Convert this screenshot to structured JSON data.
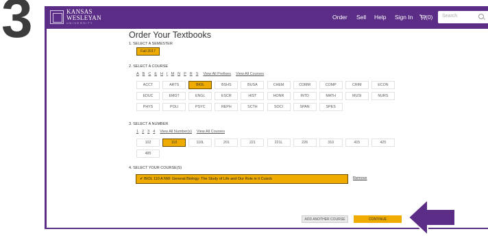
{
  "step_number": "3",
  "header": {
    "logo_line1": "KANSAS",
    "logo_line2": "WESLEYAN",
    "logo_line3": "UNIVERSITY",
    "nav": [
      {
        "label": "Order"
      },
      {
        "label": "Sell"
      },
      {
        "label": "Help"
      },
      {
        "label": "Sign In"
      }
    ],
    "cart_label": "(0)",
    "search_placeholder": "Search"
  },
  "page": {
    "title": "Order Your Textbooks",
    "semester": {
      "heading": "1. SELECT A SEMESTER",
      "selected": "Fall 2017"
    },
    "course": {
      "heading": "2. SELECT A COURSE",
      "letters": [
        "A",
        "B",
        "C",
        "E",
        "H",
        "I",
        "M",
        "N",
        "P",
        "R",
        "S"
      ],
      "view_all_prefixes": "View All Prefixes",
      "view_all_courses": "View All Courses",
      "rows": [
        [
          "ACCT",
          "ARTS",
          "BIOL",
          "BSHS",
          "BUSA",
          "CHEM",
          "COMM",
          "COMP",
          "CRIM",
          "ECON"
        ],
        [
          "EDUC",
          "EMGT",
          "ENGL",
          "ESCR",
          "HIST",
          "HONR",
          "INTD",
          "MATH",
          "MUSI",
          "NURS"
        ],
        [
          "PHYS",
          "POLI",
          "PSYC",
          "REPH",
          "SCTH",
          "SOCI",
          "SPAN",
          "SPES"
        ]
      ],
      "selected": "BIOL"
    },
    "number": {
      "heading": "3. SELECT A NUMBER",
      "pages": [
        "1",
        "2",
        "3",
        "4"
      ],
      "view_all_numbers": "View All Number(s)",
      "view_all_courses": "View All Courses",
      "rows": [
        [
          "102",
          "110",
          "110L",
          "201",
          "221",
          "221L",
          "226",
          "310",
          "415",
          "425"
        ],
        [
          "485"
        ]
      ],
      "selected": "110"
    },
    "your_courses": {
      "heading": "4. SELECT YOUR COURSE(S)",
      "item": "✔ BIOL 110 A  NW: General Biology: The Study of Life and Our Role in it Cusick",
      "remove_label": "Remove"
    },
    "buttons": {
      "add_another": "ADD ANOTHER COURSE",
      "continue": "CONTINUE"
    }
  },
  "colors": {
    "brand_purple": "#5b2d86",
    "accent_gold": "#f0ab00",
    "step_number": "#3c3c3c"
  }
}
